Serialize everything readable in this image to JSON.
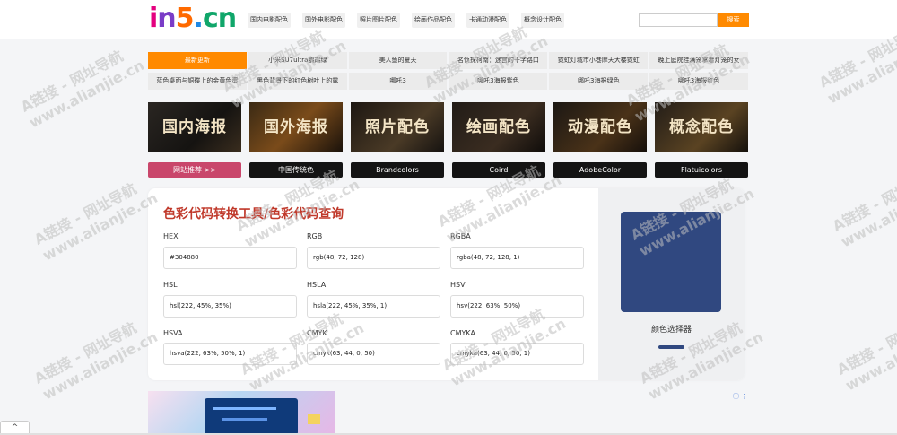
{
  "header": {
    "logo": {
      "i": "i",
      "n": "n",
      "five": "5",
      "dot": ".",
      "cn": "cn"
    },
    "nav": [
      "国内电影配色",
      "国外电影配色",
      "照片图片配色",
      "绘画作品配色",
      "卡通动漫配色",
      "概念设计配色"
    ],
    "search_placeholder": "",
    "search_button": "搜索"
  },
  "updates": {
    "row1": [
      "最新更新",
      "小米SU7ultra鹦鹉绿",
      "美人鱼的夏天",
      "名侦探柯南：迷宫的十字路口",
      "霓虹灯城市小巷摩天大楼霓虹",
      "晚上庭院挂满笼掌着灯笼的女"
    ],
    "row2": [
      "蓝色桌面与铜碟上的金黄色蛋",
      "黑色背景下的红色树叶上的露",
      "哪吒3",
      "哪吒3海报紫色",
      "哪吒3海报绿色",
      "哪吒3海报红色"
    ]
  },
  "tiles": [
    "国内海报",
    "国外海报",
    "照片配色",
    "绘画配色",
    "动漫配色",
    "概念配色"
  ],
  "links": [
    "网站推荐 >>",
    "中国传统色",
    "Brandcolors",
    "Coird",
    "AdobeColor",
    "Flatuicolors"
  ],
  "converter": {
    "title": "色彩代码转换工具/色彩代码查询",
    "fields": [
      {
        "label": "HEX",
        "value": "#304880"
      },
      {
        "label": "RGB",
        "value": "rgb(48, 72, 128)"
      },
      {
        "label": "RGBA",
        "value": "rgba(48, 72, 128, 1)"
      },
      {
        "label": "HSL",
        "value": "hsl(222, 45%, 35%)"
      },
      {
        "label": "HSLA",
        "value": "hsla(222, 45%, 35%, 1)"
      },
      {
        "label": "HSV",
        "value": "hsv(222, 63%, 50%)"
      },
      {
        "label": "HSVA",
        "value": "hsva(222, 63%, 50%, 1)"
      },
      {
        "label": "CMYK",
        "value": "cmyk(63, 44, 0, 50)"
      },
      {
        "label": "CMYKA",
        "value": "cmyka(63, 44, 0, 50, 1)"
      }
    ],
    "picker_label": "颜色选择器",
    "swatch_color": "#304880"
  },
  "watermark": {
    "line1": "A链接 - 网址导航",
    "line2": "www.alianjie.cn"
  },
  "ad": {
    "icons": "ⓘ ⋮"
  },
  "up_arrow": "^",
  "colors": {
    "accent": "#ff8a00",
    "title": "#c0392b",
    "recommend": "#c9466b"
  }
}
